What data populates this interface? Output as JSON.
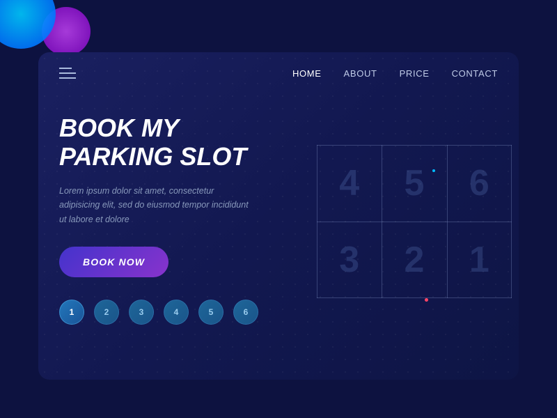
{
  "page": {
    "background_color": "#0d1240"
  },
  "nav": {
    "links": [
      {
        "label": "HOME",
        "active": true
      },
      {
        "label": "ABOUT",
        "active": false
      },
      {
        "label": "PRICE",
        "active": false
      },
      {
        "label": "CONTACT",
        "active": false
      }
    ]
  },
  "hero": {
    "title_line1": "BOOK MY",
    "title_line2": "PARKING SLOT",
    "description": "Lorem ipsum dolor sit amet, consectetur adipisicing elit, sed do eiusmod tempor incididunt ut labore et dolore",
    "cta_label": "BOOK NOW"
  },
  "parking_slots": [
    {
      "number": "4",
      "class": "s4"
    },
    {
      "number": "5",
      "class": "s5"
    },
    {
      "number": "6",
      "class": "s6"
    },
    {
      "number": "3",
      "class": "s3"
    },
    {
      "number": "2",
      "class": "s2"
    },
    {
      "number": "1",
      "class": "s1"
    }
  ],
  "pagination": {
    "items": [
      {
        "label": "1",
        "active": true
      },
      {
        "label": "2",
        "active": false
      },
      {
        "label": "3",
        "active": false
      },
      {
        "label": "4",
        "active": false
      },
      {
        "label": "5",
        "active": false
      },
      {
        "label": "6",
        "active": false
      }
    ]
  }
}
